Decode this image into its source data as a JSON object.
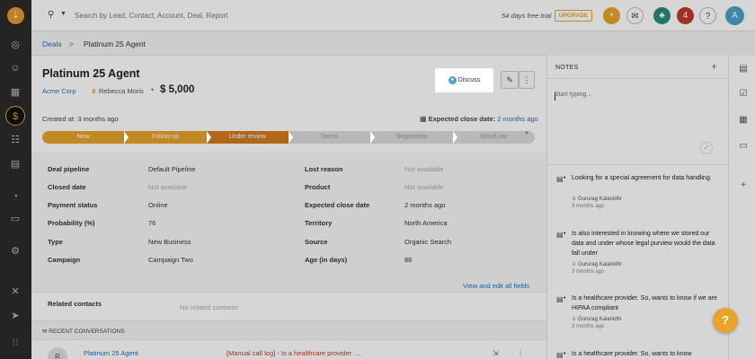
{
  "topbar": {
    "search_placeholder": "Search by Lead, Contact, Account, Deal, Report",
    "trial_text": "54 days free trial",
    "upgrade_label": "UPGRADE",
    "notification_count": "4",
    "avatar_initial": "A",
    "help_label": "?"
  },
  "breadcrumb": {
    "root": "Deals",
    "separator": ">",
    "current": "Platinum 25 Agent"
  },
  "deal": {
    "title": "Platinum 25 Agent",
    "company": "Acme Corp",
    "owner": "Rebecca Moris",
    "amount": "$ 5,000",
    "discuss_label": "Discuss",
    "created": "Created at: 3 months ago",
    "close_date_label": "Expected close date:",
    "close_date_value": "2 months ago"
  },
  "stages": [
    {
      "label": "New",
      "state": "done"
    },
    {
      "label": "Follow-up",
      "state": "done"
    },
    {
      "label": "Under review",
      "state": "current"
    },
    {
      "label": "Demo",
      "state": "todo"
    },
    {
      "label": "Negotiation",
      "state": "todo"
    },
    {
      "label": "Won/Lost",
      "state": "todo"
    }
  ],
  "fields": {
    "left": [
      {
        "label": "Deal pipeline",
        "value": "Default Pipeline",
        "muted": false
      },
      {
        "label": "Closed date",
        "value": "Not available",
        "muted": true
      },
      {
        "label": "Payment status",
        "value": "Online",
        "muted": false
      },
      {
        "label": "Probability (%)",
        "value": "76",
        "muted": false
      },
      {
        "label": "Type",
        "value": "New Business",
        "muted": false
      },
      {
        "label": "Campaign",
        "value": "Campaign Two",
        "muted": false
      }
    ],
    "right": [
      {
        "label": "Lost reason",
        "value": "Not available",
        "muted": true
      },
      {
        "label": "Product",
        "value": "Not available",
        "muted": true
      },
      {
        "label": "Expected close date",
        "value": "2 months ago",
        "muted": false
      },
      {
        "label": "Territory",
        "value": "North America",
        "muted": false
      },
      {
        "label": "Source",
        "value": "Organic Search",
        "muted": false
      },
      {
        "label": "Age (in days)",
        "value": "88",
        "muted": false
      }
    ],
    "view_all": "View and edit all fields"
  },
  "related": {
    "label": "Related contacts",
    "value": "No related contacts"
  },
  "recent": {
    "heading": "RECENT CONVERSATIONS",
    "item_title": "Platinum 25 Agent",
    "item_snippet": "[Manual call log] - Is a healthcare provider. ...",
    "item_avatar": "R"
  },
  "notes": {
    "heading": "NOTES",
    "placeholder": "Start typing...",
    "items": [
      {
        "text": "Looking for a special agreement for data handling.",
        "author": "Gururag Kalanidhi",
        "time": "3 months ago"
      },
      {
        "text": "Is also interested in knowing where we stored our data and under whose legal purview would the data fall under",
        "author": "Gururag Kalanidhi",
        "time": "3 months ago"
      },
      {
        "text": "Is a healthcare provider. So, wants to know if we are HIPAA compliant",
        "author": "Gururag Kalanidhi",
        "time": "3 months ago"
      },
      {
        "text": "Is a healthcare provider. So, wants to know",
        "author": "",
        "time": ""
      }
    ]
  },
  "colors": {
    "accent": "#e8a32c",
    "stage_current": "#d27b1c",
    "link": "#2a6fb0",
    "nav_bg": "#2b2b2b"
  }
}
